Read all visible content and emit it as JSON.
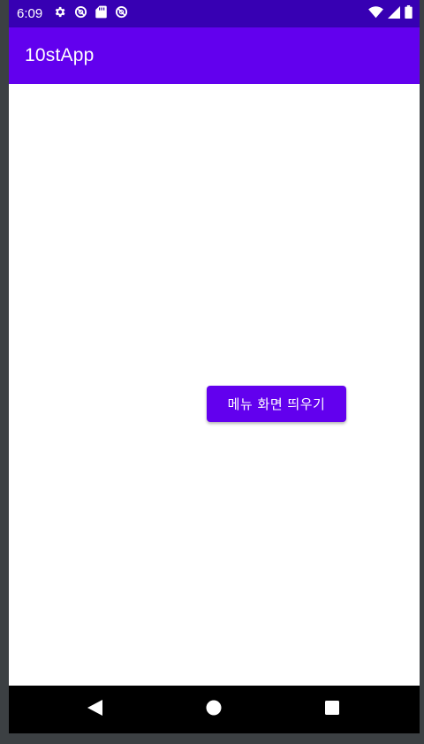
{
  "status_bar": {
    "time": "6:09",
    "left_icons": [
      "settings-icon",
      "do-not-disturb-icon",
      "sd-card-icon",
      "do-not-disturb-icon"
    ],
    "right_icons": [
      "wifi-icon",
      "signal-icon",
      "battery-icon"
    ]
  },
  "app_bar": {
    "title": "10stApp",
    "color": "#6200ee"
  },
  "main": {
    "button_label": "메뉴 화면 띄우기"
  },
  "nav_bar": {
    "buttons": [
      "back-icon",
      "home-icon",
      "recents-icon"
    ]
  },
  "colors": {
    "primary": "#6200ee",
    "primary_dark": "#3700b3",
    "nav": "#000000"
  }
}
